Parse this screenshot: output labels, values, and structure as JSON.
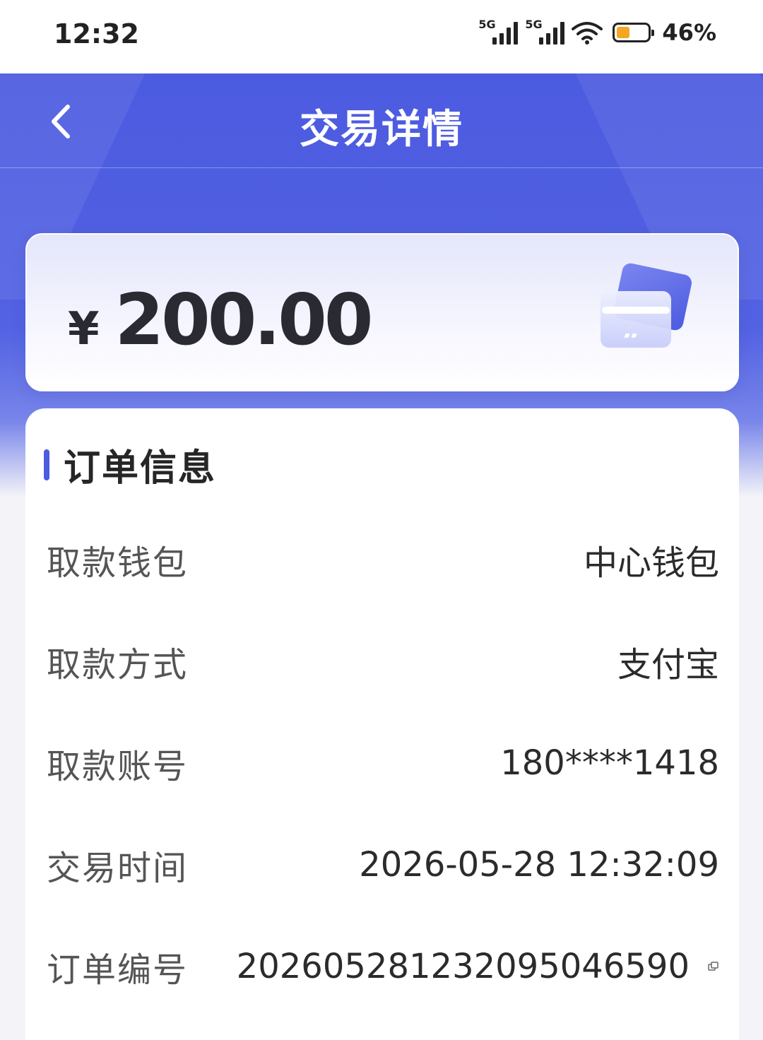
{
  "status_bar": {
    "time": "12:32",
    "network_1": "5G",
    "network_2": "5G",
    "battery": "46%"
  },
  "header": {
    "title": "交易详情",
    "back_icon": "chevron-left-icon"
  },
  "amount_card": {
    "currency": "¥",
    "amount": "200.00",
    "icon": "card-icon"
  },
  "order_info": {
    "title": "订单信息",
    "rows": [
      {
        "label": "取款钱包",
        "value": "中心钱包"
      },
      {
        "label": "取款方式",
        "value": "支付宝"
      },
      {
        "label": "取款账号",
        "value": "180****1418"
      },
      {
        "label": "交易时间",
        "value": "2026-05-28 12:32:09"
      },
      {
        "label": "订单编号",
        "value": "202605281232095046590"
      }
    ]
  },
  "colors": {
    "accent": "#4c5be0",
    "battery": "#f5a623"
  }
}
